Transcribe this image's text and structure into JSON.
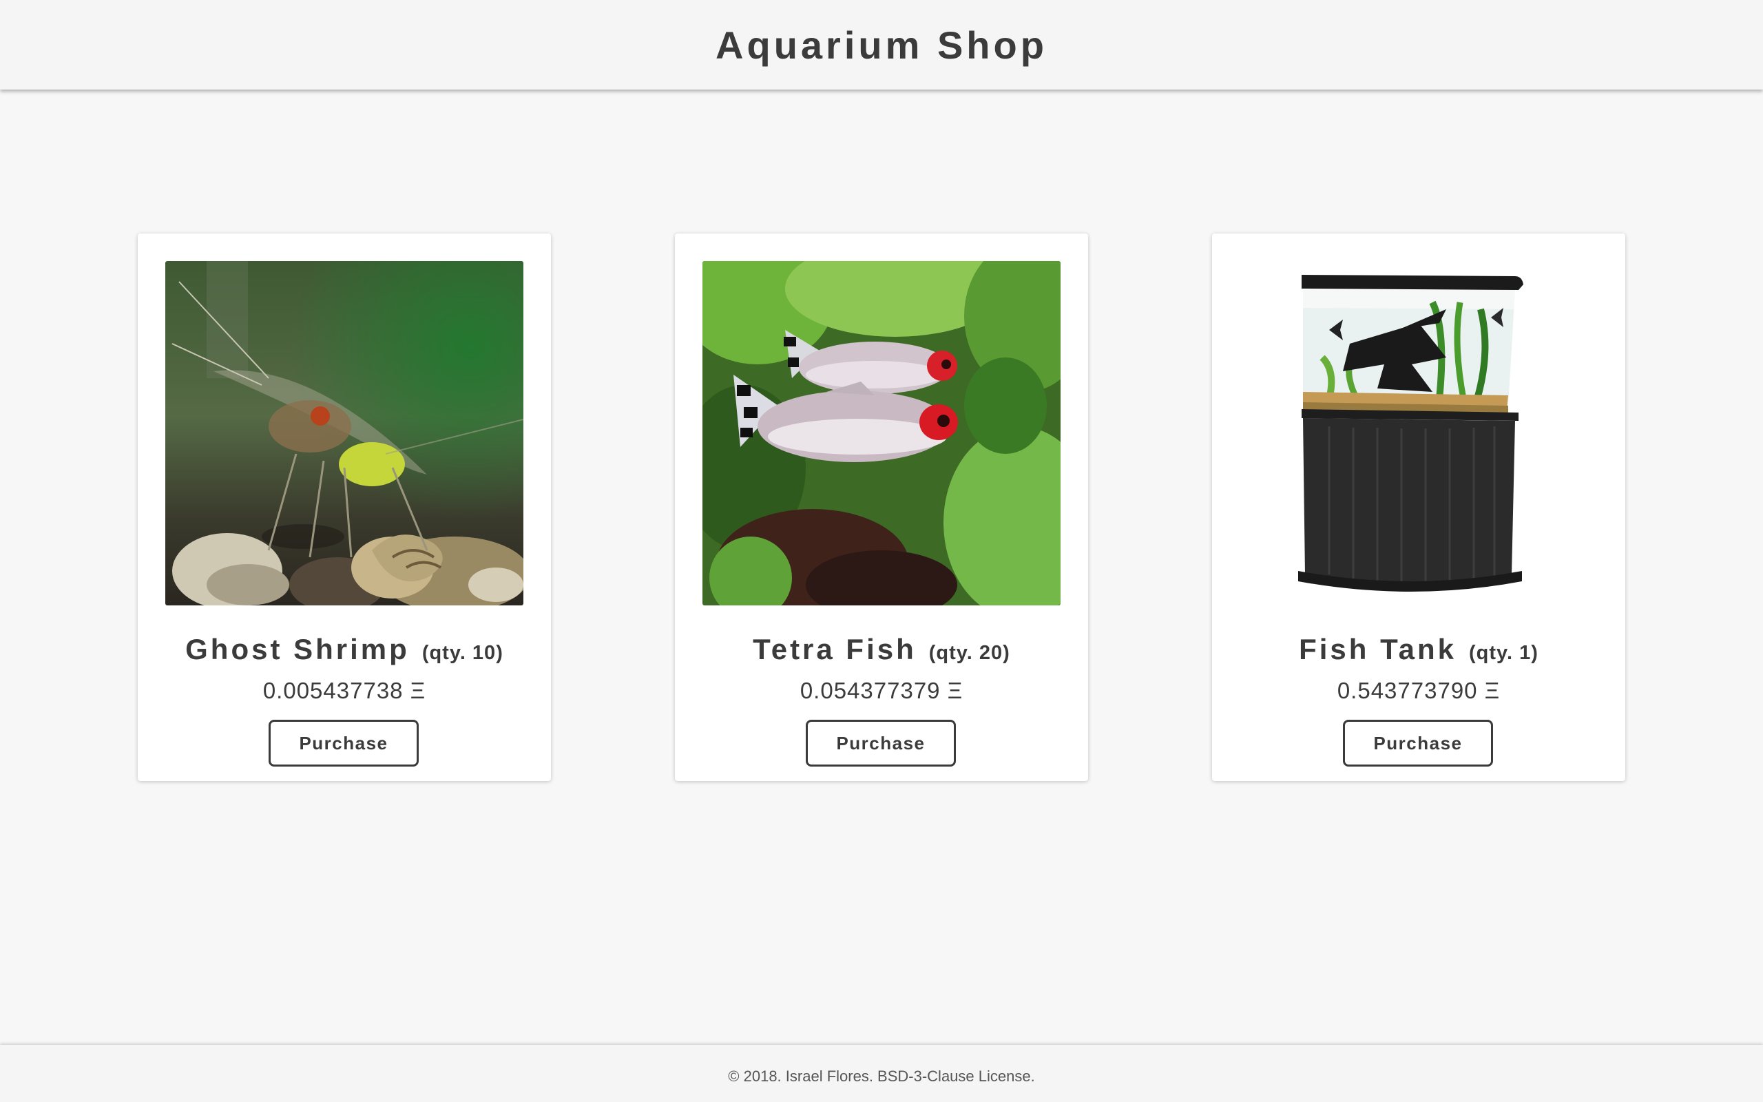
{
  "header": {
    "title": "Aquarium Shop"
  },
  "products": [
    {
      "name": "Ghost Shrimp",
      "qty": "(qty. 10)",
      "price": "0.005437738 Ξ",
      "button": "Purchase",
      "image": "ghost-shrimp-photo"
    },
    {
      "name": "Tetra Fish",
      "qty": "(qty. 20)",
      "price": "0.054377379 Ξ",
      "button": "Purchase",
      "image": "tetra-fish-photo"
    },
    {
      "name": "Fish Tank",
      "qty": "(qty. 1)",
      "price": "0.543773790 Ξ",
      "button": "Purchase",
      "image": "fish-tank-photo"
    }
  ],
  "footer": {
    "text": "© 2018. Israel Flores. BSD-3-Clause License."
  }
}
